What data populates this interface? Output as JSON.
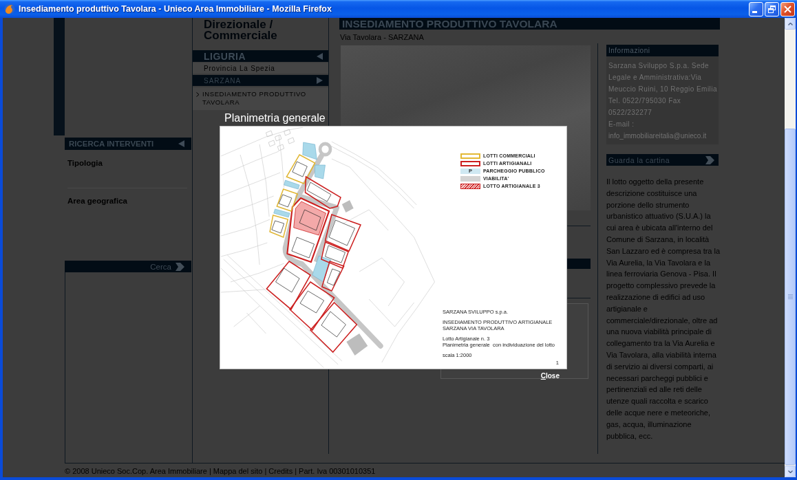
{
  "window": {
    "title": "Insediamento produttivo Tavolara - Unieco Area Immobiliare - Mozilla Firefox"
  },
  "search_panel": {
    "title": "RICERCA INTERVENTI",
    "fields": [
      {
        "label": "Tipologia"
      },
      {
        "label": "Area geografica"
      }
    ],
    "button": "Cerca"
  },
  "nav": {
    "heading": "Direzionale / Commerciale",
    "items": [
      {
        "kind": "region",
        "label": "LIGURIA"
      },
      {
        "kind": "province",
        "label": "Provincia La Spezia"
      },
      {
        "kind": "town",
        "label": "SARZANA"
      },
      {
        "kind": "project",
        "label": "INSEDIAMENTO PRODUTTIVO TAVOLARA"
      }
    ]
  },
  "project": {
    "title": "INSEDIAMENTO PRODUTTIVO TAVOLARA",
    "location": "Via Tavolara - SARZANA"
  },
  "info": {
    "title": "Informazioni",
    "address": "Sarzana Sviluppo S.p.a. Sede Legale e Amministrativa:Via Meuccio Ruini, 10 Reggio Emilia Tel. 0522/795030 Fax 0522/232277",
    "email_label": "E-mail :",
    "email": "info_immobiliareitalia@unieco.it",
    "map_link": "Guarda la cartina",
    "description": "Il lotto oggetto della presente descrizione costituisce una porzione dello strumento urbanistico attuativo (S.U.A.) la cui area è ubicata all'interno del Comune di Sarzana, in località San Lazzaro ed è compresa tra la Via Aurelia, la Via Tavolara e la linea ferroviaria Genova - Pisa. Il progetto complessivo prevede la realizzazione di edifici ad uso artigianale e commerciale/direzionale, oltre ad una nuova viabilità principale di collegamento tra la Via Aurelia e Via Tavolara, alla viabilità interna di servizio ai diversi comparti, ai necessari parcheggi pubblici e pertinenziali ed alle reti delle utenze quali raccolta e scarico delle acque nere e meteoriche, gas, acqua, illuminazione pubblica, ecc."
  },
  "footer": "© 2008 Unieco Soc.Cop. Area Immobiliare | Mappa del sito | Credits | Part. Iva 00301010351",
  "lightbox": {
    "caption": "Planimetria generale",
    "legend": [
      {
        "kind": "outline",
        "label": "LOTTI COMMERCIALI",
        "color": "#e3b833"
      },
      {
        "kind": "outline",
        "label": "LOTTI ARTIGIANALI",
        "color": "#cc1f1f"
      },
      {
        "kind": "fill",
        "label": "PARCHEGGIO PUBBLICO",
        "color": "#cfe8f2",
        "symbol": "P"
      },
      {
        "kind": "fill",
        "label": "VIABILITA'",
        "color": "#d3d3d3"
      },
      {
        "kind": "hatch",
        "label": "LOTTO ARTIGIANALE 3",
        "color": "#cc1f1f"
      }
    ],
    "title_block": [
      [
        "SARZANA SVILUPPO s.p.a."
      ],
      [
        "INSEDIAMENTO PRODUTTIVO ARTIGIANALE",
        "SARZANA VIA TAVOLARA"
      ],
      [
        "Lotto Artigianale n. 3",
        "Planimetria generale  con individuazione del lotto"
      ],
      [
        "scala 1:2000"
      ]
    ],
    "sheet_number": "1",
    "close": "Close"
  }
}
